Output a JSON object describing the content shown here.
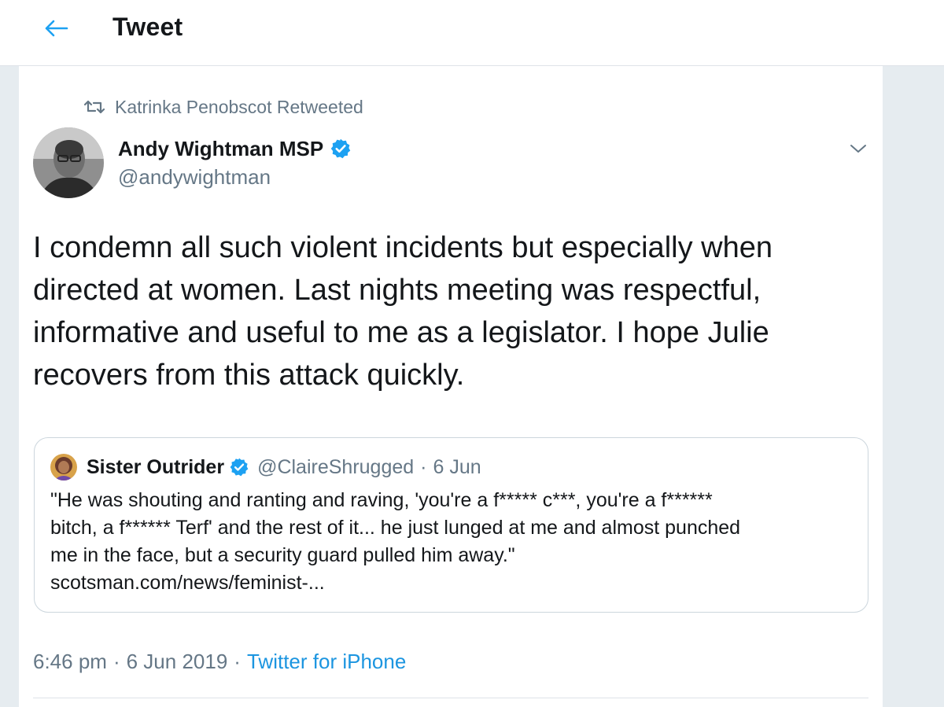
{
  "header": {
    "title": "Tweet",
    "back_icon": "arrow-left-icon"
  },
  "colors": {
    "accent": "#1da1f2",
    "link": "#1b95e0",
    "secondary_text": "#657786",
    "border": "#ccd6dd",
    "gutter": "#e6ecf0"
  },
  "retweet": {
    "icon": "retweet-icon",
    "label": "Katrinka Penobscot Retweeted"
  },
  "author": {
    "name": "Andy Wightman MSP",
    "handle": "@andywightman",
    "verified_icon": "verified-badge-icon"
  },
  "tweet": {
    "lines": [
      "I condemn all such violent incidents but especially when",
      "directed at women. Last nights meeting was respectful,",
      "informative and useful to me as a legislator. I hope Julie",
      "recovers from this attack quickly."
    ]
  },
  "quote": {
    "name": "Sister Outrider",
    "handle": "@ClaireShrugged",
    "separator": "·",
    "date": "6 Jun",
    "lines": [
      "\"He was shouting and ranting and raving, 'you're a f***** c***, you're a f******",
      "bitch, a f****** Terf' and the rest of it... he just lunged at me and almost punched",
      "me in the face, but a security guard pulled him away.\"",
      "scotsman.com/news/feminist-..."
    ]
  },
  "meta": {
    "time": "6:46 pm",
    "separator": "·",
    "date": "6 Jun 2019",
    "source": "Twitter for iPhone"
  }
}
